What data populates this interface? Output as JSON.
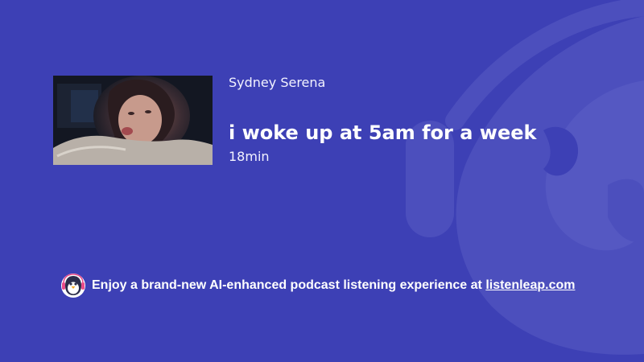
{
  "episode": {
    "author": "Sydney Serena",
    "title": "i woke up at 5am for a week",
    "duration": "18min"
  },
  "promo": {
    "text": "Enjoy a brand-new AI-enhanced podcast listening experience at",
    "link_text": "listenleap.com"
  },
  "icons": {
    "watermark": "penguin-headphones-icon",
    "promo_logo": "penguin-mascot-icon"
  },
  "colors": {
    "background": "#3d40b5",
    "watermark": "#4c4fbd",
    "text": "#ffffff"
  }
}
